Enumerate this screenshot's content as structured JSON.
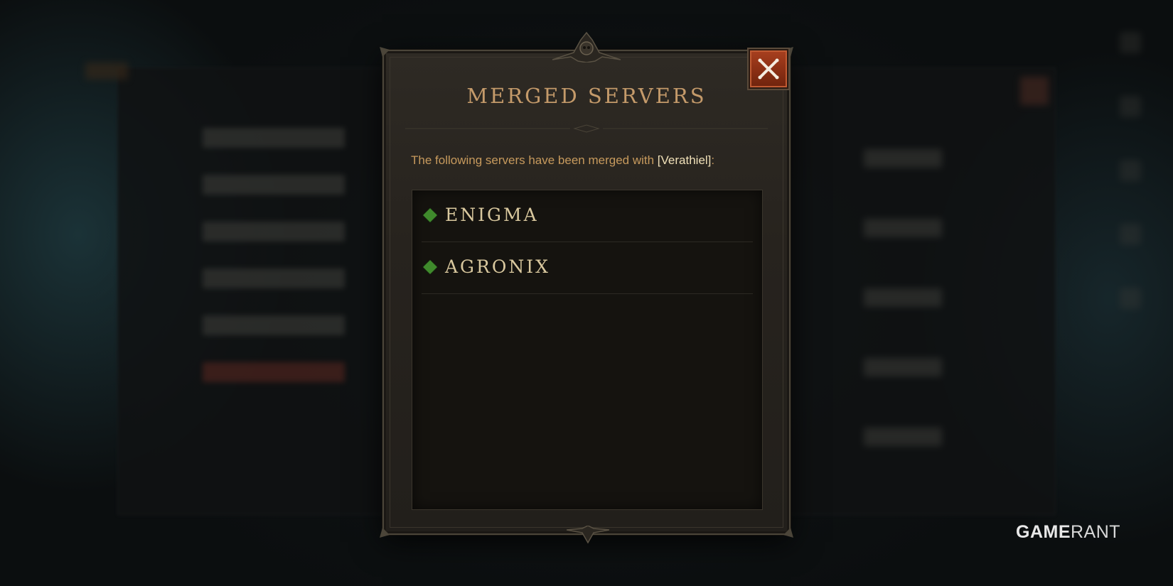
{
  "dialog": {
    "title": "MERGED SERVERS",
    "message_prefix": "The following servers have been merged with ",
    "message_server": "[Verathiel]",
    "message_suffix": ":",
    "servers": [
      {
        "name": "ENIGMA"
      },
      {
        "name": "AGRONIX"
      }
    ],
    "close_icon": "close-x-icon",
    "bullet_icon": "green-diamond-icon"
  },
  "watermark": {
    "part1": "GAME",
    "part2": "RANT"
  },
  "colors": {
    "title": "#c49a6a",
    "message": "#c79a5d",
    "server_highlight": "#f0e0b8",
    "bullet": "#3f8a2c",
    "close_button": "#8a2f14"
  }
}
